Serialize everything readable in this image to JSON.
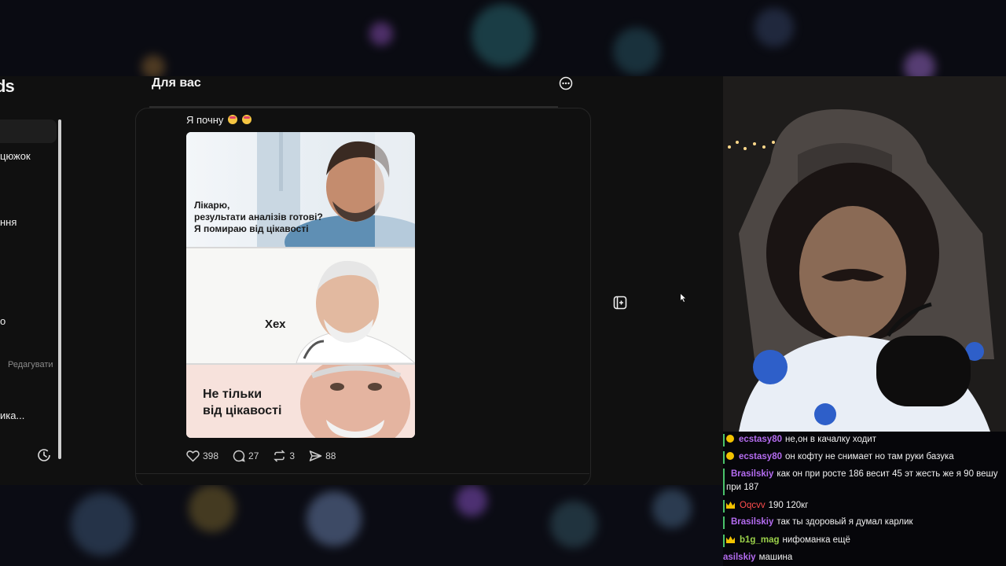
{
  "app": {
    "logo": "ds"
  },
  "sidebar": {
    "items": [
      {
        "label": "цюжок"
      },
      {
        "label": "ння"
      },
      {
        "label": "о"
      },
      {
        "label": "ика..."
      }
    ],
    "edit_label": "Редагувати"
  },
  "feed": {
    "title": "Для вас"
  },
  "post": {
    "text": "Я почну",
    "meme_captions": {
      "panel1": [
        "Лікарю,",
        "результати аналізів готові?",
        "Я помираю від цікавості"
      ],
      "panel2": "Хех",
      "panel3": [
        "Не тільки",
        "від цікавості"
      ]
    },
    "likes": "398",
    "comments": "27",
    "reposts": "3",
    "shares": "88"
  },
  "chat": {
    "messages": [
      {
        "user": "ecstasy80",
        "color": "#b46cf0",
        "text": "не,он в качалку ходит",
        "badge": "coin"
      },
      {
        "user": "ecstasy80",
        "color": "#b46cf0",
        "text": "он кофту не снимает но там руки базука",
        "badge": "coin"
      },
      {
        "user": "Brasilskiy",
        "color": "#b46cf0",
        "text": "как он при росте 186 весит 45 эт жесть же я 90 вешу",
        "cont": "при 187",
        "badge": ""
      },
      {
        "user": "Oqcvv",
        "color": "#ff4d4d",
        "text": "190 120кг",
        "badge": "crown"
      },
      {
        "user": "Brasilskiy",
        "color": "#b46cf0",
        "text": "так ты здоровый я думал карлик",
        "badge": ""
      },
      {
        "user": "b1g_mag",
        "color": "#9bd14a",
        "text": "нифоманка ещё",
        "badge": "crown"
      },
      {
        "user": "asilskiy",
        "color": "#b46cf0",
        "text": "машина",
        "badge": ""
      }
    ]
  },
  "colors": {
    "app_bg": "#101010",
    "accent_green": "#4ac36b"
  }
}
